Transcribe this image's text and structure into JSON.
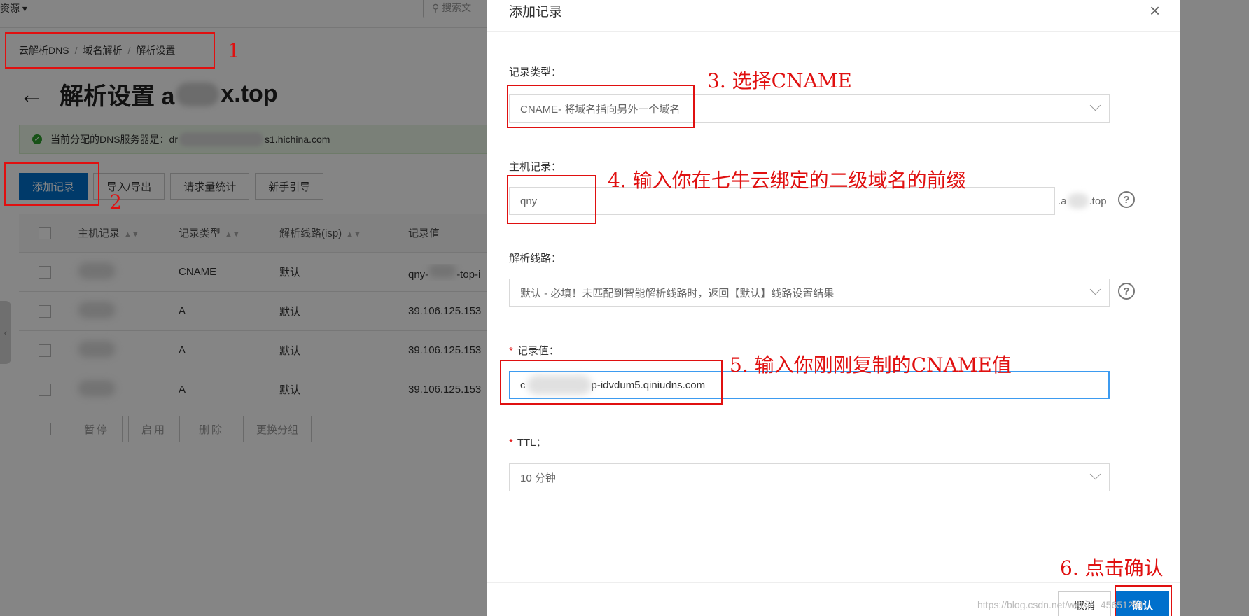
{
  "background": {
    "top_resource": "资源",
    "search_placeholder": "搜索文",
    "breadcrumb": [
      "云解析DNS",
      "域名解析",
      "解析设置"
    ],
    "page_title_prefix": "解析设置 a",
    "page_title_suffix": "x.top",
    "dns_notice_prefix": "当前分配的DNS服务器是：dr",
    "dns_notice_suffix": "s1.hichina.com",
    "toolbar": [
      "添加记录",
      "导入/导出",
      "请求量统计",
      "新手引导"
    ],
    "table": {
      "headers": [
        "主机记录",
        "记录类型",
        "解析线路(isp)",
        "记录值"
      ],
      "rows": [
        {
          "type": "CNAME",
          "line": "默认",
          "value_prefix": "qny-",
          "value_suffix": "-top-i"
        },
        {
          "type": "A",
          "line": "默认",
          "value_prefix": "39.106.125.153",
          "value_suffix": ""
        },
        {
          "type": "A",
          "line": "默认",
          "value_prefix": "39.106.125.153",
          "value_suffix": ""
        },
        {
          "type": "A",
          "line": "默认",
          "value_prefix": "39.106.125.153",
          "value_suffix": ""
        }
      ]
    },
    "bulk_actions": [
      "暂停",
      "启用",
      "删除",
      "更换分组"
    ]
  },
  "drawer": {
    "title": "添加记录",
    "close_glyph": "×",
    "record_type_label": "记录类型：",
    "record_type_value": "CNAME- 将域名指向另外一个域名",
    "host_label": "主机记录：",
    "host_value": "qny",
    "host_suffix_a": ".a",
    "host_suffix_b": ".top",
    "line_label": "解析线路：",
    "line_value": "默认 - 必填！未匹配到智能解析线路时，返回【默认】线路设置结果",
    "value_label": "记录值：",
    "value_prefix": "c",
    "value_suffix": "p-idvdum5.qiniudns.com",
    "ttl_label": "TTL：",
    "ttl_value": "10 分钟",
    "cancel_label": "取消",
    "ok_label": "确认"
  },
  "annotations": {
    "n1": "1",
    "n2": "2",
    "n3": "3. 选择CNAME",
    "n4": "4. 输入你在七牛云绑定的二级域名的前缀",
    "n5": "5. 输入你刚刚复制的CNAME值",
    "n6": "6. 点击确认"
  },
  "watermark": "https://blog.csdn.net/weixin_45651291"
}
